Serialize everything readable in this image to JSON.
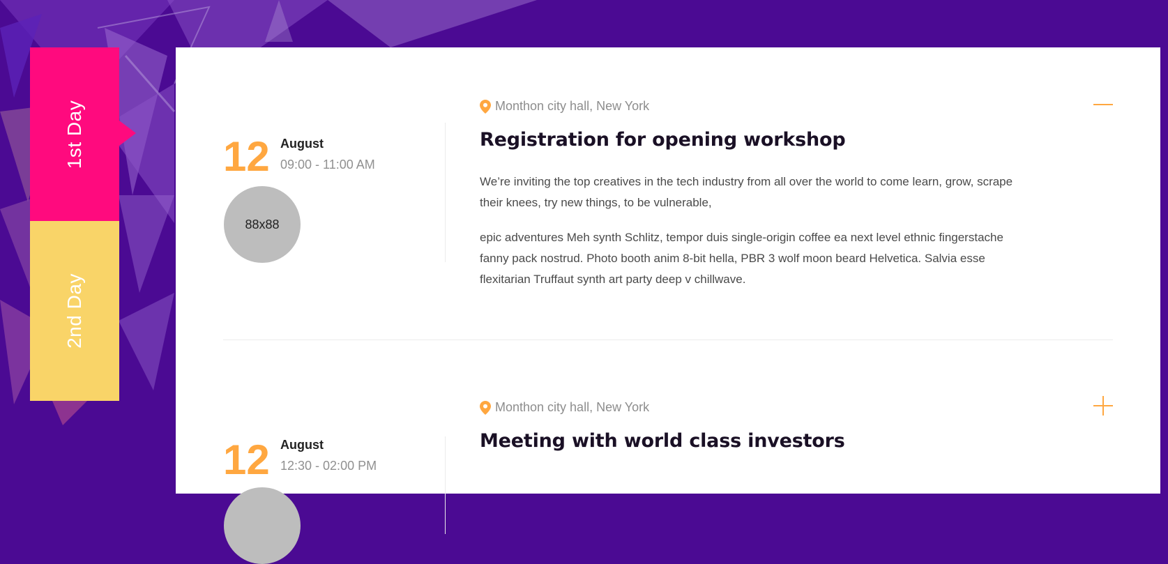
{
  "days": [
    {
      "label": "1st Day",
      "active": true
    },
    {
      "label": "2nd Day",
      "active": false
    }
  ],
  "sessions": [
    {
      "day": "12",
      "month": "August",
      "time": "09:00 - 11:00 AM",
      "avatar_placeholder": "88x88",
      "location": "Monthon city hall, New York",
      "title": "Registration for opening workshop",
      "paragraphs": [
        "We’re inviting the top creatives in the tech industry from all over the world to come learn, grow, scrape their knees, try new things, to be vulnerable,",
        "epic adventures Meh synth Schlitz, tempor duis single-origin coffee ea next level ethnic fingerstache fanny pack nostrud. Photo booth anim 8-bit hella, PBR 3 wolf moon beard Helvetica. Salvia esse flexitarian Truffaut synth art party deep v chillwave."
      ],
      "expanded": true,
      "toggle_icon": "minus-icon"
    },
    {
      "day": "12",
      "month": "August",
      "time": "12:30 - 02:00 PM",
      "location": "Monthon city hall, New York",
      "title": "Meeting with world class investors",
      "expanded": false,
      "toggle_icon": "plus-icon"
    }
  ],
  "colors": {
    "background": "#4b0a93",
    "active_tab": "#ff0a7e",
    "inactive_tab": "#f9d468",
    "accent": "#ffa740",
    "title": "#1a1025"
  }
}
